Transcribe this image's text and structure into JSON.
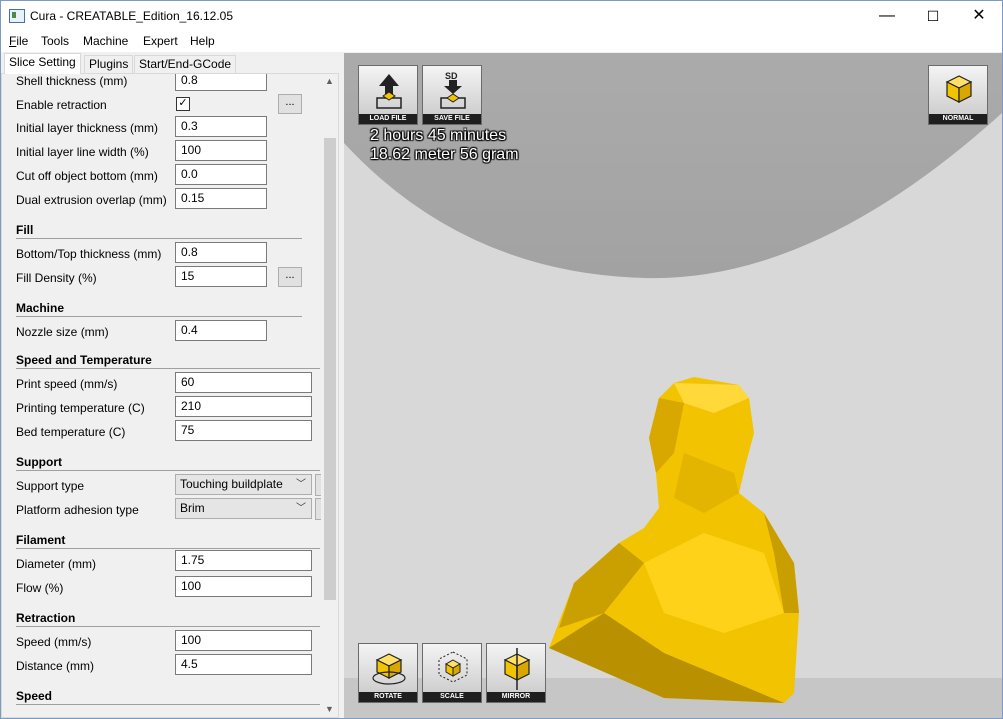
{
  "window": {
    "title": "Cura - CREATABLE_Edition_16.12.05",
    "min": "—",
    "max": "☐",
    "close": "✕"
  },
  "menu": [
    {
      "u": "F",
      "rest": "ile"
    },
    {
      "u": "",
      "rest": "Tools"
    },
    {
      "u": "",
      "rest": "Machine"
    },
    {
      "u": "",
      "rest": "Expert"
    },
    {
      "u": "",
      "rest": "Help"
    }
  ],
  "tabs": [
    "Slice Setting",
    "Plugins",
    "Start/End-GCode"
  ],
  "settings": {
    "shell_thickness": {
      "label": "Shell thickness (mm)",
      "value": "0.8"
    },
    "enable_retraction": {
      "label": "Enable retraction",
      "checked": "✓",
      "more": "..."
    },
    "initial_layer_thickness": {
      "label": "Initial layer thickness (mm)",
      "value": "0.3"
    },
    "initial_layer_line_width": {
      "label": "Initial layer line width (%)",
      "value": "100"
    },
    "cut_off_object_bottom": {
      "label": "Cut off object bottom (mm)",
      "value": "0.0"
    },
    "dual_extrusion_overlap": {
      "label": "Dual extrusion overlap (mm)",
      "value": "0.15"
    },
    "fill_section": "Fill",
    "bottom_top_thickness": {
      "label": "Bottom/Top thickness (mm)",
      "value": "0.8"
    },
    "fill_density": {
      "label": "Fill Density (%)",
      "value": "15",
      "more": "..."
    },
    "machine_section": "Machine",
    "nozzle_size": {
      "label": "Nozzle size (mm)",
      "value": "0.4"
    },
    "speed_temp_section": "Speed and Temperature",
    "print_speed": {
      "label": "Print speed (mm/s)",
      "value": "60"
    },
    "printing_temperature": {
      "label": "Printing temperature (C)",
      "value": "210"
    },
    "bed_temperature": {
      "label": "Bed temperature (C)",
      "value": "75"
    },
    "support_section": "Support",
    "support_type": {
      "label": "Support type",
      "value": "Touching buildplate"
    },
    "platform_adhesion": {
      "label": "Platform adhesion type",
      "value": "Brim"
    },
    "filament_section": "Filament",
    "diameter": {
      "label": "Diameter (mm)",
      "value": "1.75"
    },
    "flow": {
      "label": "Flow (%)",
      "value": "100"
    },
    "retraction_section": "Retraction",
    "retraction_speed": {
      "label": "Speed (mm/s)",
      "value": "100"
    },
    "retraction_distance": {
      "label": "Distance (mm)",
      "value": "4.5"
    },
    "speed_section": "Speed"
  },
  "viewport": {
    "load_file": "LOAD FILE",
    "save_file": "SAVE FILE",
    "sd_label": "SD",
    "normal": "NORMAL",
    "rotate": "ROTATE",
    "scale": "SCALE",
    "mirror": "MIRROR",
    "print_time": "2 hours 45 minutes",
    "print_material": "18.62 meter 56 gram"
  },
  "colors": {
    "model": "#f5c400",
    "model_shadow": "#b48c00",
    "bg": "#d9d9d9",
    "dome": "#a8a8a8"
  }
}
